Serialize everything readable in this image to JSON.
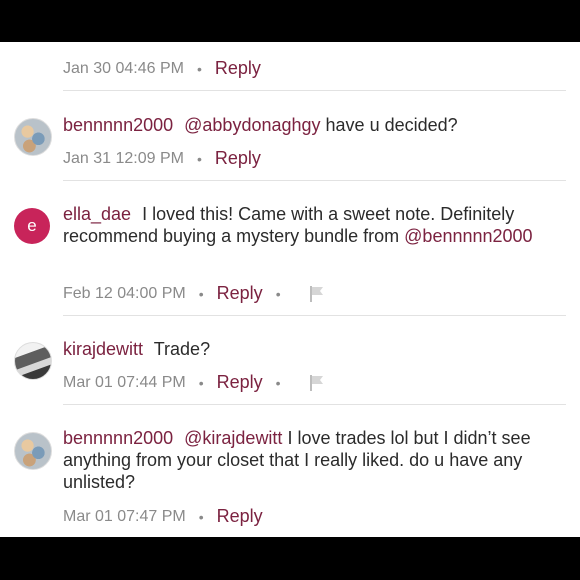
{
  "comments": [
    {
      "meta": {
        "time": "Jan 30 04:46 PM",
        "reply_label": "Reply"
      }
    },
    {
      "user": "bennnnn2000",
      "mention": "@abbydonaghgy",
      "text": " have u decided?",
      "meta": {
        "time": "Jan 31 12:09 PM",
        "reply_label": "Reply"
      },
      "avatar": "photo-avatar"
    },
    {
      "user": "ella_dae",
      "text": "I loved this! Came with a sweet note. Definitely recommend buying a mystery bundle from ",
      "mention_end": "@bennnnn2000",
      "avatar_letter": "e",
      "meta": {
        "time": "Feb 12 04:00 PM",
        "reply_label": "Reply"
      }
    },
    {
      "user": "kirajdewitt",
      "text": "Trade?",
      "avatar": "photo-avatar",
      "meta": {
        "time": "Mar 01 07:44 PM",
        "reply_label": "Reply"
      }
    },
    {
      "user": "bennnnn2000",
      "mention": "@kirajdewitt",
      "text": " I love trades lol but I didn’t see anything from your closet that I really liked. do u have any unlisted?",
      "avatar": "photo-avatar",
      "meta": {
        "time": "Mar 01 07:47 PM",
        "reply_label": "Reply"
      }
    }
  ],
  "icons": {
    "flag": "flag-icon",
    "separator": "•"
  },
  "colors": {
    "accent": "#7b2240",
    "avatar_letter_bg": "#c8245a",
    "meta_text": "#8a8a8a",
    "divider": "#e2e2e2"
  }
}
